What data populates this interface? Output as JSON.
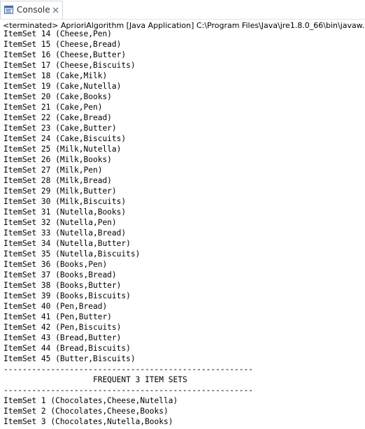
{
  "tab": {
    "label": "Console",
    "icon": "console-icon",
    "close_icon": "close-icon"
  },
  "status": {
    "text": "<terminated> AprioriAlgorithm [Java Application] C:\\Program Files\\Java\\jre1.8.0_66\\bin\\javaw.exe"
  },
  "output": {
    "lines": [
      "ItemSet 14 (Cheese,Pen)",
      "ItemSet 15 (Cheese,Bread)",
      "ItemSet 16 (Cheese,Butter)",
      "ItemSet 17 (Cheese,Biscuits)",
      "ItemSet 18 (Cake,Milk)",
      "ItemSet 19 (Cake,Nutella)",
      "ItemSet 20 (Cake,Books)",
      "ItemSet 21 (Cake,Pen)",
      "ItemSet 22 (Cake,Bread)",
      "ItemSet 23 (Cake,Butter)",
      "ItemSet 24 (Cake,Biscuits)",
      "ItemSet 25 (Milk,Nutella)",
      "ItemSet 26 (Milk,Books)",
      "ItemSet 27 (Milk,Pen)",
      "ItemSet 28 (Milk,Bread)",
      "ItemSet 29 (Milk,Butter)",
      "ItemSet 30 (Milk,Biscuits)",
      "ItemSet 31 (Nutella,Books)",
      "ItemSet 32 (Nutella,Pen)",
      "ItemSet 33 (Nutella,Bread)",
      "ItemSet 34 (Nutella,Butter)",
      "ItemSet 35 (Nutella,Biscuits)",
      "ItemSet 36 (Books,Pen)",
      "ItemSet 37 (Books,Bread)",
      "ItemSet 38 (Books,Butter)",
      "ItemSet 39 (Books,Biscuits)",
      "ItemSet 40 (Pen,Bread)",
      "ItemSet 41 (Pen,Butter)",
      "ItemSet 42 (Pen,Biscuits)",
      "ItemSet 43 (Bread,Butter)",
      "ItemSet 44 (Bread,Biscuits)",
      "ItemSet 45 (Butter,Biscuits)",
      "-----------------------------------------------------",
      "                   FREQUENT 3 ITEM SETS",
      "-----------------------------------------------------",
      "ItemSet 1 (Chocolates,Cheese,Nutella)",
      "ItemSet 2 (Chocolates,Cheese,Books)",
      "ItemSet 3 (Chocolates,Nutella,Books)"
    ]
  }
}
